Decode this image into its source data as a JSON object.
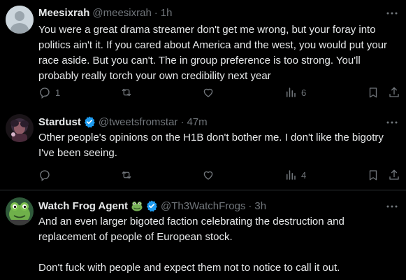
{
  "tweets": [
    {
      "name": "Meesixrah",
      "handle": "@meesixrah",
      "separator": "·",
      "time": "1h",
      "verified": false,
      "text": "You were a great drama streamer don't get me wrong, but your foray into politics ain't it. If you cared about America and the west, you would put your race aside. But you can't. The in group preference is too strong. You'll probably really torch your own credibility next year",
      "replies": "1",
      "reposts": "",
      "likes": "",
      "views": "6"
    },
    {
      "name": "Stardust",
      "handle": "@tweetsfromstar",
      "separator": "·",
      "time": "47m",
      "verified": true,
      "text": "Other people's opinions on the H1B don't bother me. I don't like the bigotry I've been seeing.",
      "replies": "",
      "reposts": "",
      "likes": "",
      "views": "4"
    },
    {
      "name": "Watch Frog Agent",
      "name_emoji": "frog-face",
      "handle": "@Th3WatchFrogs",
      "separator": "·",
      "time": "3h",
      "verified": true,
      "text": "And an even larger bigoted faction celebrating the destruction and replacement of people of European stock.\n\nDon't fuck with people and expect them not to notice to call it out."
    }
  ],
  "colors": {
    "background": "#000000",
    "text": "#e7e9ea",
    "secondary": "#71767b",
    "verified": "#1d9bf0",
    "divider": "#2f3336"
  }
}
